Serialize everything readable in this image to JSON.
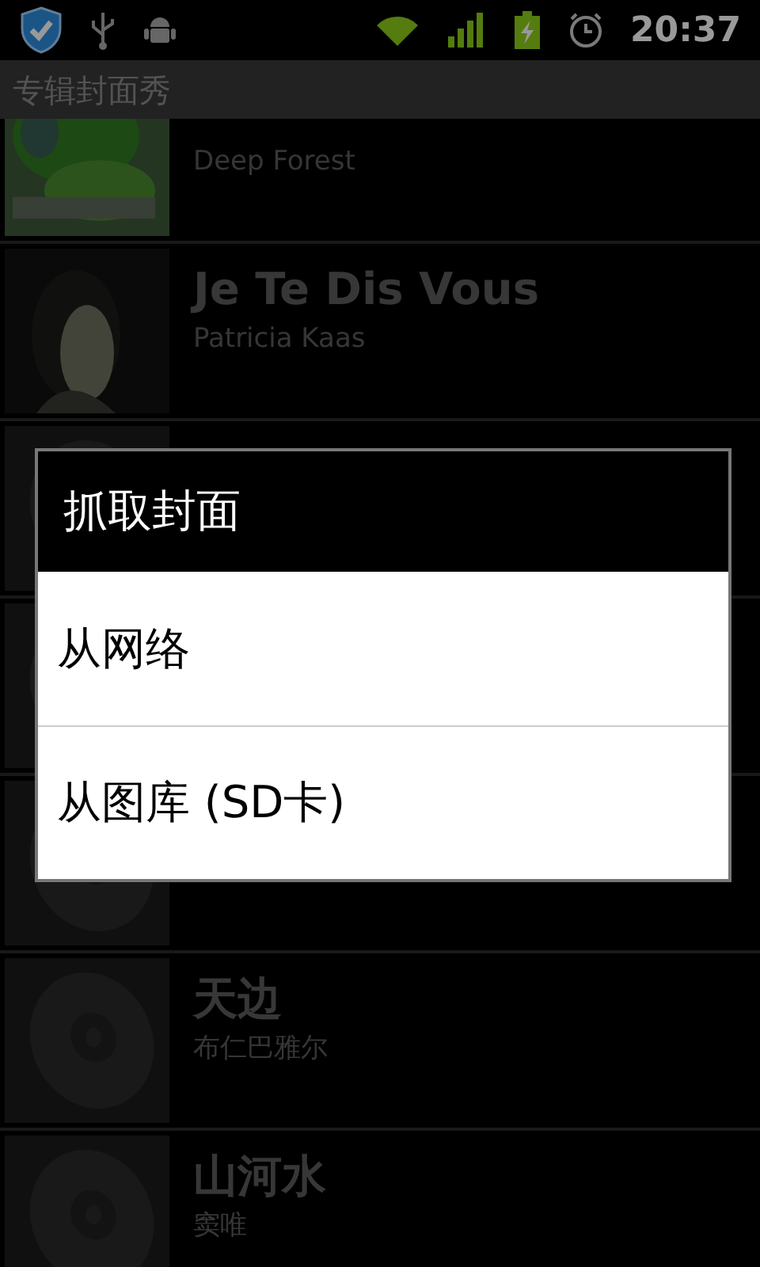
{
  "status_bar": {
    "time": "20:37"
  },
  "app_bar": {
    "title": "专辑封面秀"
  },
  "albums": [
    {
      "kind": "picture",
      "artist": "Deep Forest"
    },
    {
      "kind": "picture",
      "title": "Je Te Dis Vous",
      "artist": "Patricia Kaas"
    },
    {
      "kind": "disc"
    },
    {
      "kind": "disc"
    },
    {
      "kind": "disc"
    },
    {
      "kind": "disc",
      "title": "天边",
      "artist": "布仁巴雅尔"
    },
    {
      "kind": "disc",
      "title": "山河水",
      "artist": "窦唯"
    }
  ],
  "dialog": {
    "title": "抓取封面",
    "options": [
      "从网络",
      "从图库 (SD卡)"
    ]
  }
}
